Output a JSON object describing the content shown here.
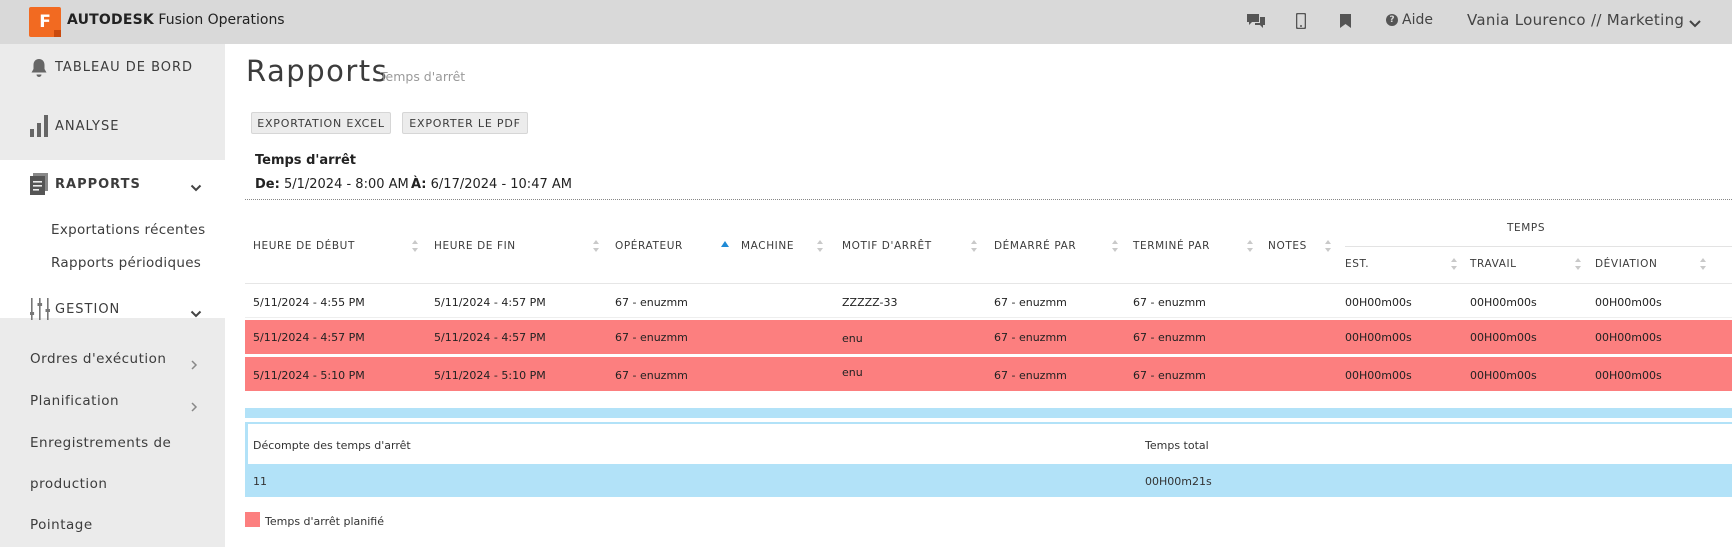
{
  "topbar": {
    "logo_letter": "F",
    "brand_bold": "AUTODESK",
    "brand_rest": "Fusion Operations",
    "aide": "Aide",
    "user": "Vania Lourenco // Marketing",
    "icons": [
      "chat-icon",
      "mobile-icon",
      "bookmark-icon",
      "help-icon",
      "chevron-down-icon"
    ]
  },
  "sidebar": {
    "items": [
      {
        "label": "TABLEAU DE BORD",
        "icon": "bell-icon"
      },
      {
        "label": "ANALYSE",
        "icon": "bar-chart-icon"
      },
      {
        "label": "RAPPORTS",
        "icon": "report-icon"
      },
      {
        "label": "GESTION",
        "icon": "sliders-icon"
      }
    ],
    "rapports_sub": [
      "Exportations récentes",
      "Rapports périodiques"
    ],
    "gestion_sub": [
      {
        "label": "Ordres d'exécution",
        "has_chevron": true
      },
      {
        "label": "Planification",
        "has_chevron": true
      },
      {
        "label": "Enregistrements de",
        "has_chevron": false
      },
      {
        "label": "production",
        "has_chevron": false
      },
      {
        "label": "Pointage",
        "has_chevron": false
      }
    ]
  },
  "page": {
    "title": "Rapports",
    "subtitle": "Temps d'arrêt",
    "export_excel": "EXPORTATION EXCEL",
    "export_pdf": "EXPORTER LE PDF",
    "report_title": "Temps d'arrêt",
    "from_label": "De:",
    "from_value": "5/1/2024 - 8:00 AM",
    "to_label": "À:",
    "to_value": "6/17/2024 - 10:47 AM"
  },
  "table": {
    "headers": {
      "start": "HEURE DE DÉBUT",
      "end": "HEURE DE FIN",
      "operator": "OPÉRATEUR",
      "machine": "MACHINE",
      "reason": "MOTIF D'ARRÊT",
      "started_by": "DÉMARRÉ PAR",
      "ended_by": "TERMINÉ PAR",
      "notes": "NOTES",
      "temps": "TEMPS",
      "est": "EST.",
      "travail": "TRAVAIL",
      "deviation": "DÉVIATION"
    },
    "rows": [
      {
        "start": "5/11/2024 - 4:55 PM",
        "end": "5/11/2024 - 4:57 PM",
        "operator": "67 - enuzmm",
        "machine": "",
        "reason": "ZZZZZ-33",
        "started_by": "67 - enuzmm",
        "ended_by": "67 - enuzmm",
        "notes": "",
        "est": "00H00m00s",
        "travail": "00H00m00s",
        "deviation": "00H00m00s",
        "planned": false
      },
      {
        "start": "5/11/2024 - 4:57 PM",
        "end": "5/11/2024 - 4:57 PM",
        "operator": "67 - enuzmm",
        "machine": "",
        "reason": "enu",
        "started_by": "67 - enuzmm",
        "ended_by": "67 - enuzmm",
        "notes": "",
        "est": "00H00m00s",
        "travail": "00H00m00s",
        "deviation": "00H00m00s",
        "planned": true
      },
      {
        "start": "5/11/2024 - 5:10 PM",
        "end": "5/11/2024 - 5:10 PM",
        "operator": "67 - enuzmm",
        "machine": "",
        "reason": "enu",
        "started_by": "67 - enuzmm",
        "ended_by": "67 - enuzmm",
        "notes": "",
        "est": "00H00m00s",
        "travail": "00H00m00s",
        "deviation": "00H00m00s",
        "planned": true
      }
    ]
  },
  "summary": {
    "count_label": "Décompte des temps d'arrêt",
    "total_label": "Temps total",
    "count_value": "11",
    "total_value": "00H00m21s"
  },
  "legend": {
    "label": "Temps d'arrêt planifié",
    "color": "#fc7f7f"
  },
  "colors": {
    "topbar": "#d9d9d9",
    "sidebar": "#ebebeb",
    "brand_orange": "#f26a21",
    "planned_row": "#fc7f7f",
    "summary_blue": "#b2e2f8",
    "sort_active": "#1f8ad6"
  }
}
